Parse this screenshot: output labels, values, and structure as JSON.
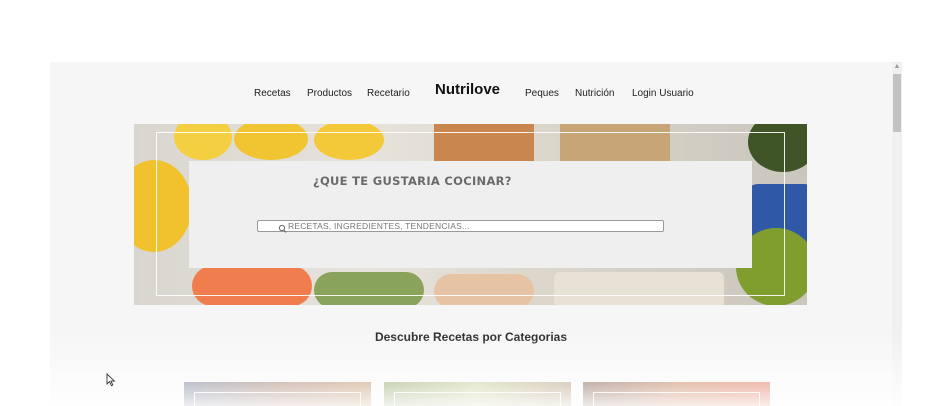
{
  "nav": {
    "items_left": [
      "Recetas",
      "Productos",
      "Recetario"
    ],
    "brand": "Nutrilove",
    "items_right": [
      "Peques",
      "Nutrición",
      "Login Usuario"
    ]
  },
  "hero": {
    "title": "¿QUE TE GUSTARIA COCINAR?",
    "search_placeholder": "RECETAS, INGREDIENTES, TENDENCIAS..."
  },
  "section": {
    "title": "Descubre Recetas por Categorias"
  },
  "colors": {
    "page_bg": "#f6f6f6",
    "card_bg": "#efefef",
    "lemon": "#f2c12e",
    "avocado": "#6f8e2a",
    "salmon": "#f07a4a"
  }
}
